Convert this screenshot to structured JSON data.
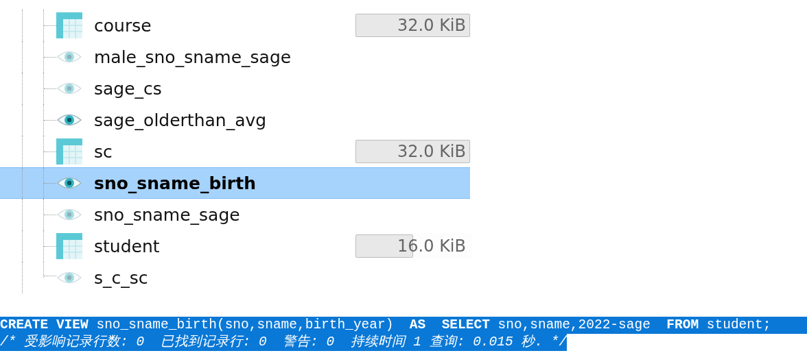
{
  "tree": {
    "items": [
      {
        "kind": "table",
        "name": "course",
        "size": "32.0 KiB",
        "level": 1,
        "selected": false
      },
      {
        "kind": "view",
        "name": "male_sno_sname_sage",
        "dimmed": true,
        "selected": false
      },
      {
        "kind": "view",
        "name": "sage_cs",
        "dimmed": true,
        "selected": false
      },
      {
        "kind": "view",
        "name": "sage_olderthan_avg",
        "dimmed": false,
        "selected": false
      },
      {
        "kind": "table",
        "name": "sc",
        "size": "32.0 KiB",
        "level": 1,
        "selected": false
      },
      {
        "kind": "view",
        "name": "sno_sname_birth",
        "dimmed": false,
        "selected": true
      },
      {
        "kind": "view",
        "name": "sno_sname_sage",
        "dimmed": true,
        "selected": false
      },
      {
        "kind": "table",
        "name": "student",
        "size": "16.0 KiB",
        "level": 0.5,
        "selected": false
      },
      {
        "kind": "view",
        "name": "s_c_sc",
        "dimmed": true,
        "selected": false
      }
    ]
  },
  "sql_log": {
    "lines": [
      {
        "kind": "statement",
        "text": "**CREATE VIEW** sno_sname_birth(sno,sname,birth_year)  **AS**  **SELECT** sno,sname,2022-sage  **FROM** student;"
      },
      {
        "kind": "comment",
        "text": "/* 受影响记录行数: 0  已找到记录行: 0  警告: 0  持续时间 1 查询: 0.015 秒. */"
      }
    ]
  }
}
